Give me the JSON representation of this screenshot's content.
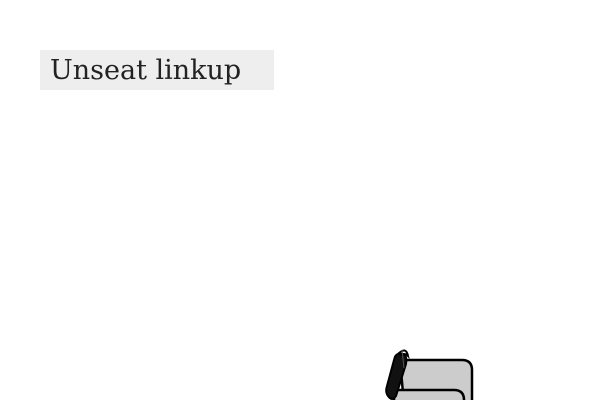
{
  "header": {
    "label": "Unseat linkup"
  },
  "icons": {
    "scroll": "scroll-icon"
  },
  "colors": {
    "label_background": "#eeeeee",
    "scroll_fill": "#cccccc",
    "scroll_outline": "#000000"
  }
}
